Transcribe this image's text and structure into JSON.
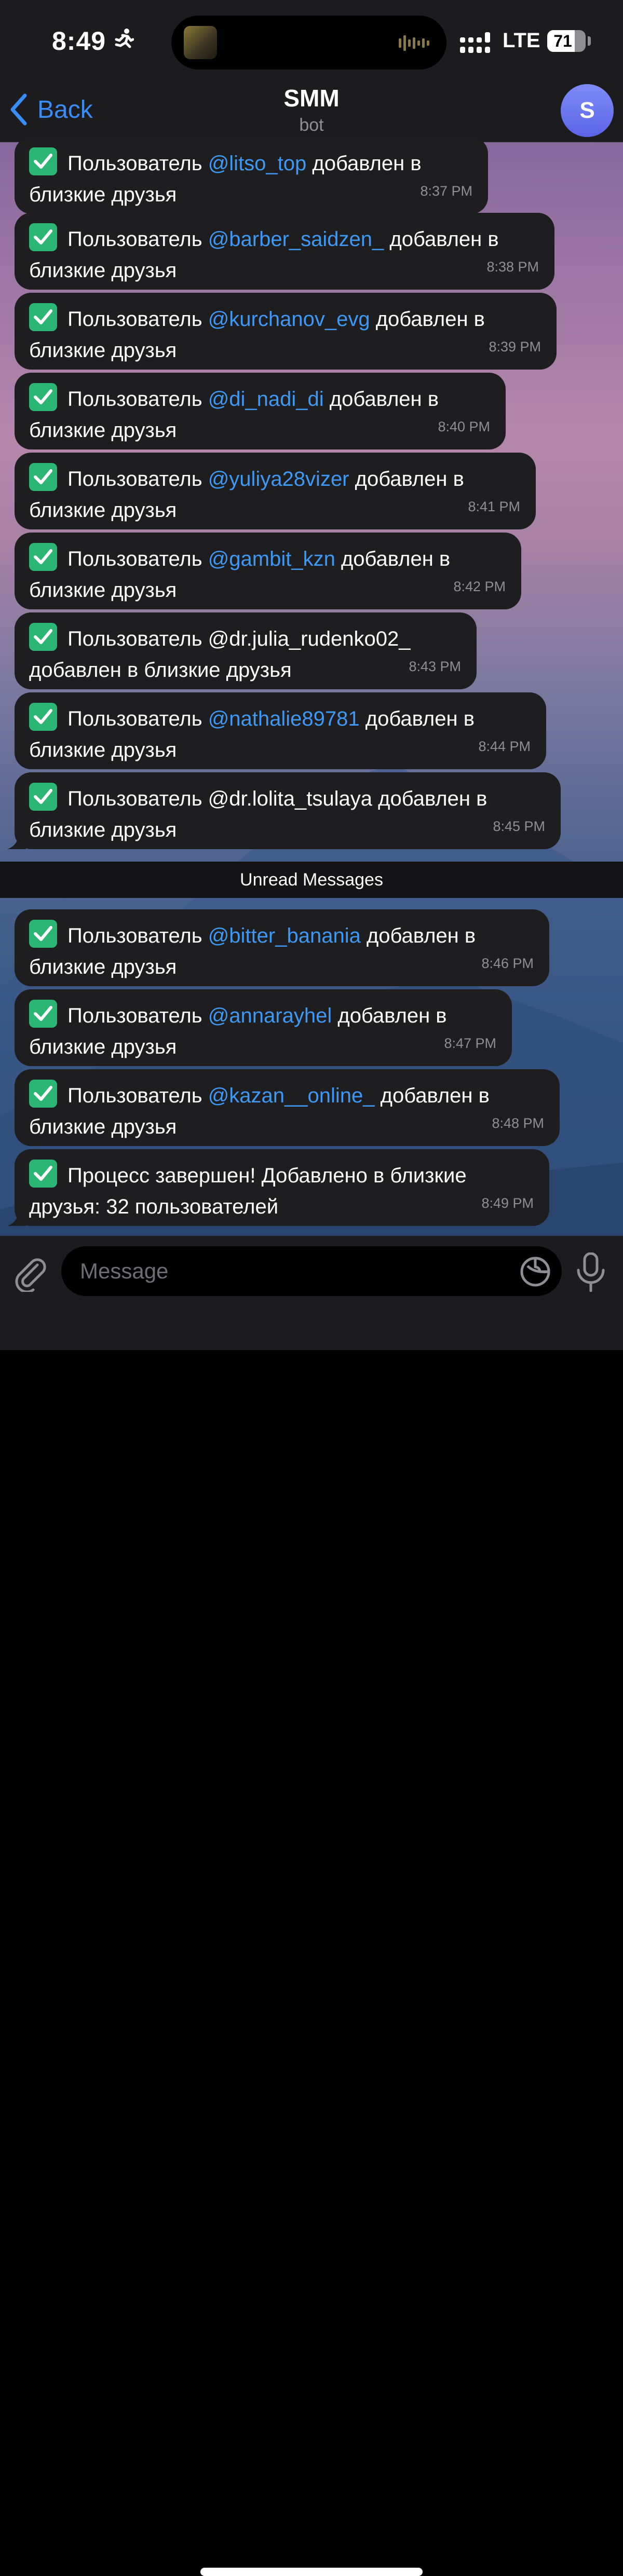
{
  "status_bar": {
    "time": "8:49",
    "network": "LTE",
    "battery_percent": "71",
    "battery_level": 0.71
  },
  "header": {
    "back_label": "Back",
    "title": "SMM",
    "subtitle": "bot",
    "avatar_letter": "S"
  },
  "messages": [
    {
      "prefix": "Пользователь ",
      "mention": "@litso_top",
      "suffix": " добавлен в близкие друзья",
      "time": "8:37 PM"
    },
    {
      "prefix": "Пользователь ",
      "mention": "@barber_saidzen_",
      "suffix": " добавлен в близкие друзья",
      "time": "8:38 PM"
    },
    {
      "prefix": "Пользователь ",
      "mention": "@kurchanov_evg",
      "suffix": " добавлен в близкие друзья",
      "time": "8:39 PM"
    },
    {
      "prefix": "Пользователь ",
      "mention": "@di_nadi_di",
      "suffix": " добавлен в близкие друзья",
      "time": "8:40 PM"
    },
    {
      "prefix": "Пользователь ",
      "mention": "@yuliya28vizer",
      "suffix": " добавлен в близкие друзья",
      "time": "8:41 PM"
    },
    {
      "prefix": "Пользователь ",
      "mention": "@gambit_kzn",
      "suffix": " добавлен в близкие друзья",
      "time": "8:42 PM"
    },
    {
      "prefix": "Пользователь @dr.julia_rudenko02_ добавлен в близкие друзья",
      "mention": "",
      "suffix": "",
      "time": "8:43 PM"
    },
    {
      "prefix": "Пользователь ",
      "mention": "@nathalie89781",
      "suffix": " добавлен в близкие друзья",
      "time": "8:44 PM"
    },
    {
      "prefix": "Пользователь @dr.lolita_tsulaya добавлен в близкие друзья",
      "mention": "",
      "suffix": "",
      "time": "8:45 PM"
    },
    {
      "prefix": "Пользователь ",
      "mention": "@bitter_banania",
      "suffix": " добавлен в близкие друзья",
      "time": "8:46 PM"
    },
    {
      "prefix": "Пользователь ",
      "mention": "@annarayhel",
      "suffix": " добавлен в близкие друзья",
      "time": "8:47 PM"
    },
    {
      "prefix": "Пользователь ",
      "mention": "@kazan__online_",
      "suffix": " добавлен в близкие друзья",
      "time": "8:48 PM"
    },
    {
      "prefix": "Процесс завершен! Добавлено в близкие друзья: 32 пользователей",
      "mention": "",
      "suffix": "",
      "time": "8:49 PM"
    }
  ],
  "unread_divider": "Unread Messages",
  "composer": {
    "placeholder": "Message"
  },
  "colors": {
    "accent": "#3a8df5",
    "mention": "#3e99f6",
    "bubble": "#1e1e20",
    "check": "#2bb673"
  }
}
